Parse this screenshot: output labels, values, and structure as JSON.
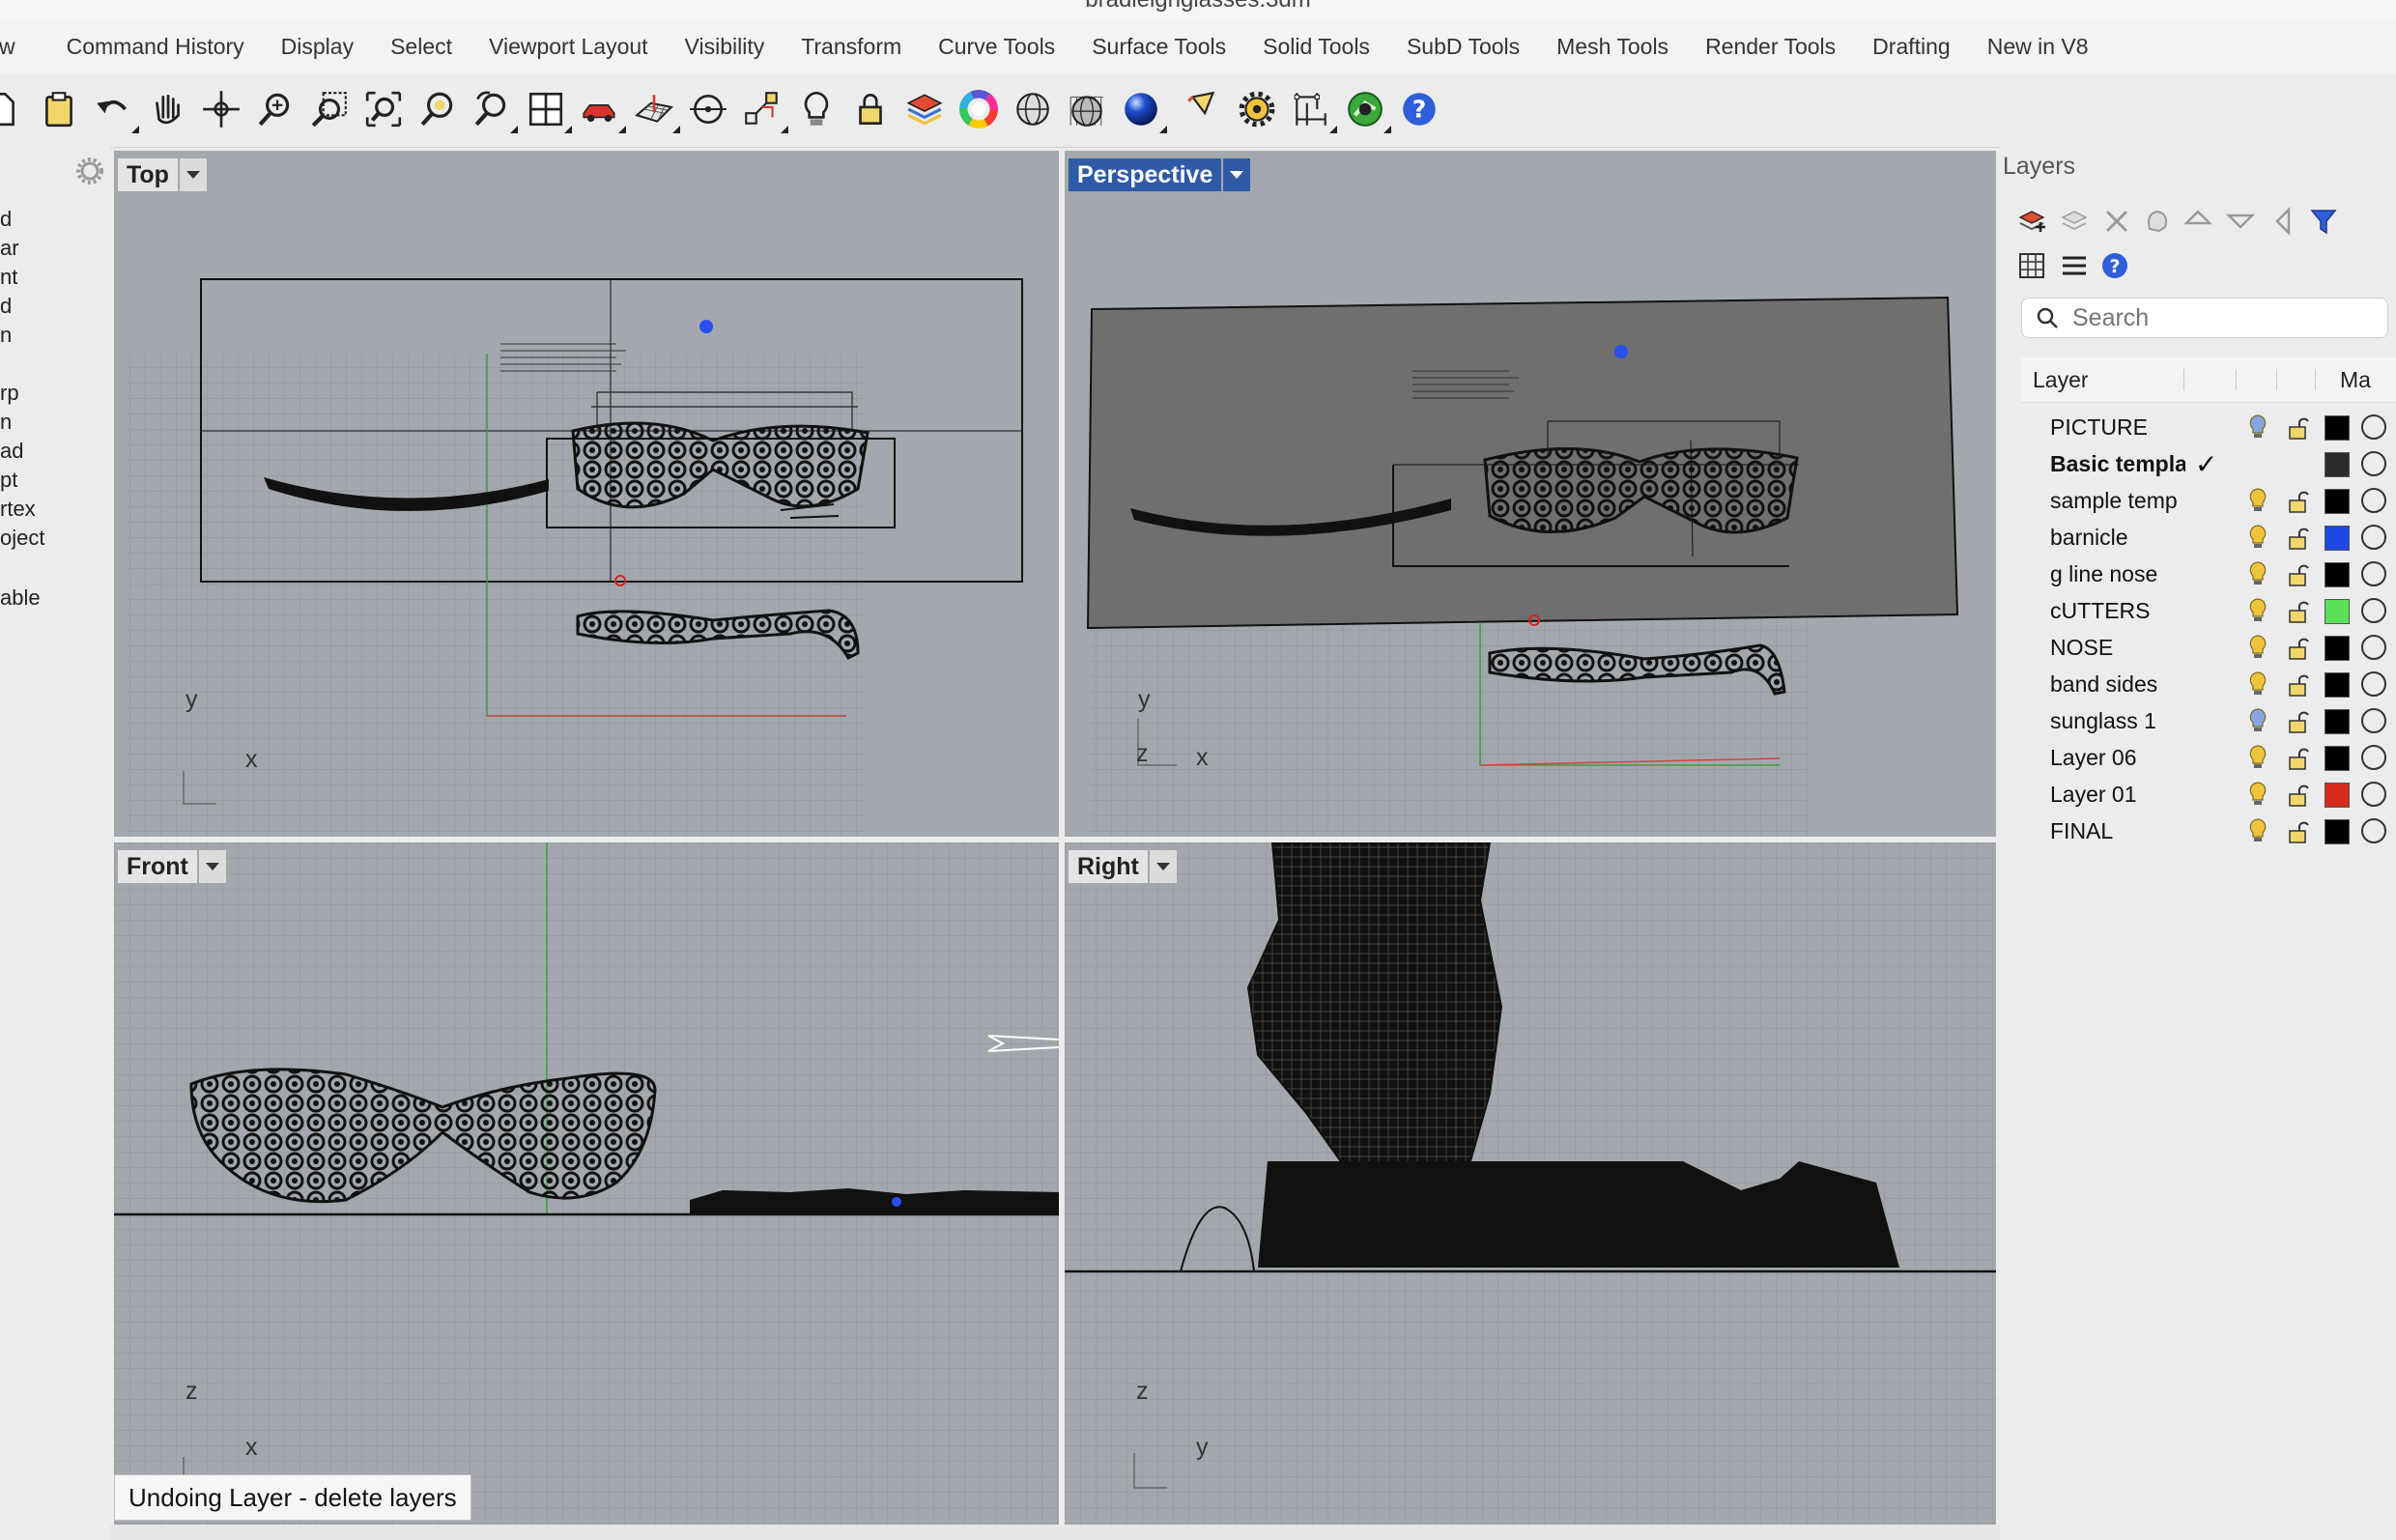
{
  "window": {
    "title": "bradleighglasses.3dm"
  },
  "menu": [
    "w",
    "Command History",
    "Display",
    "Select",
    "Viewport Layout",
    "Visibility",
    "Transform",
    "Curve Tools",
    "Surface Tools",
    "Solid Tools",
    "SubD Tools",
    "Mesh Tools",
    "Render Tools",
    "Drafting",
    "New in V8"
  ],
  "left_panel": {
    "items": [
      "d",
      "ar",
      "nt",
      "d",
      "n",
      "rp",
      "n",
      "ad",
      "pt",
      "rtex",
      "oject",
      "able"
    ]
  },
  "viewports": {
    "top": {
      "label": "Top",
      "axis_v": "y",
      "axis_h": "x"
    },
    "perspective": {
      "label": "Perspective",
      "axis_v": "y",
      "axis_z": "z",
      "axis_h": "x"
    },
    "front": {
      "label": "Front",
      "axis_v": "z",
      "axis_h": "x"
    },
    "right": {
      "label": "Right",
      "axis_v": "z",
      "axis_h": "y"
    }
  },
  "layers_panel": {
    "title": "Layers",
    "search_placeholder": "Search",
    "col_layer": "Layer",
    "col_material": "Ma",
    "rows": [
      {
        "name": "PICTURE",
        "current": false,
        "bulb": "#8aa6e0",
        "color": "#000000"
      },
      {
        "name": "Basic templa",
        "current": true,
        "bulb": "",
        "color": "#2b2b2b"
      },
      {
        "name": "sample temp",
        "current": false,
        "bulb": "#f0c43a",
        "color": "#000000"
      },
      {
        "name": "barnicle",
        "current": false,
        "bulb": "#f0c43a",
        "color": "#1f47e6"
      },
      {
        "name": "g line nose",
        "current": false,
        "bulb": "#f0c43a",
        "color": "#000000"
      },
      {
        "name": "cUTTERS",
        "current": false,
        "bulb": "#f0c43a",
        "color": "#5be05a"
      },
      {
        "name": "NOSE",
        "current": false,
        "bulb": "#f0c43a",
        "color": "#000000"
      },
      {
        "name": "band sides",
        "current": false,
        "bulb": "#f0c43a",
        "color": "#000000"
      },
      {
        "name": "sunglass 1",
        "current": false,
        "bulb": "#8aa6e0",
        "color": "#000000"
      },
      {
        "name": "Layer 06",
        "current": false,
        "bulb": "#f0c43a",
        "color": "#000000"
      },
      {
        "name": "Layer 01",
        "current": false,
        "bulb": "#f0c43a",
        "color": "#d42a1e"
      },
      {
        "name": "FINAL",
        "current": false,
        "bulb": "#f0c43a",
        "color": "#000000"
      }
    ]
  },
  "status": {
    "message": "Undoing Layer - delete layers"
  }
}
